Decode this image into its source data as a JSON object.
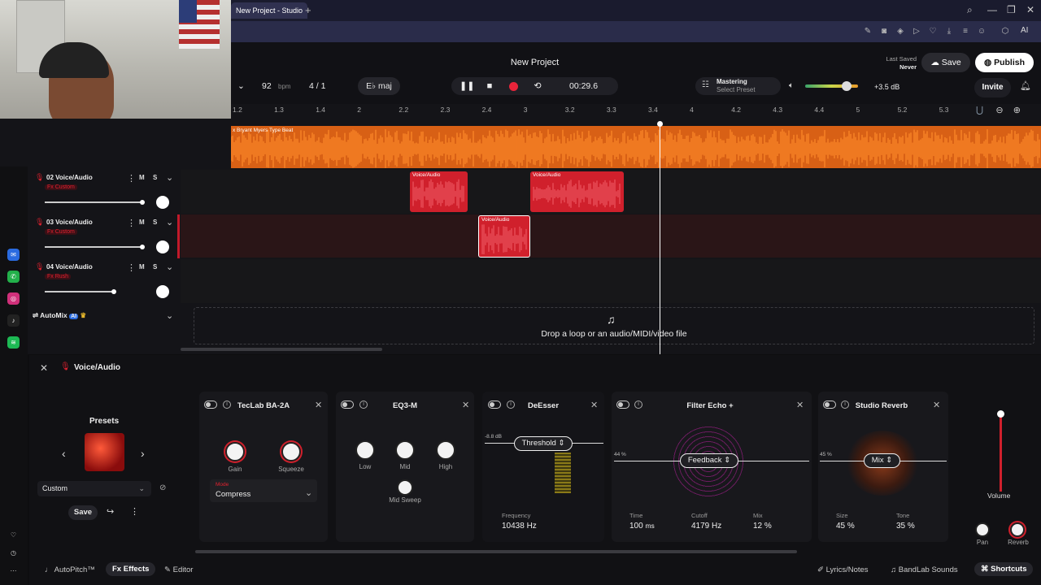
{
  "browser": {
    "tab_title": "New Project - Studio",
    "tab_plus": "+",
    "win_controls": [
      "⌕",
      "—",
      "❐",
      "✕"
    ],
    "ai_label": "AI"
  },
  "header": {
    "project_title": "New Project",
    "last_saved_label": "Last Saved",
    "last_saved_value": "Never",
    "save_label": "Save",
    "publish_label": "Publish",
    "invite_label": "Invite",
    "bpm_value": "92",
    "bpm_unit": "bpm",
    "time_signature": "4 / 1",
    "key": "E♭ maj",
    "time": "00:29.6",
    "mastering_label": "Mastering",
    "mastering_preset": "Select Preset",
    "volume_db": "+3.5 dB",
    "volume_level": 0.78
  },
  "ruler": {
    "ticks": [
      "1.2",
      "1.3",
      "1.4",
      "2",
      "2.2",
      "2.3",
      "2.4",
      "3",
      "3.2",
      "3.3",
      "3.4",
      "4",
      "4.2",
      "4.3",
      "4.4",
      "5",
      "5.2",
      "5.3"
    ]
  },
  "tracks": [
    {
      "name": "x Bryant Myers Type Beat",
      "color": "#d86015"
    },
    {
      "number": "02",
      "name": "Voice/Audio",
      "fx": "Fx Custom",
      "clips": [
        "Voice/Audio",
        "Voice/Audio"
      ]
    },
    {
      "number": "03",
      "name": "Voice/Audio",
      "fx": "Fx Custom",
      "clips": [
        "Voice/Audio"
      ]
    },
    {
      "number": "04",
      "name": "Voice/Audio",
      "fx": "Fx Rush",
      "clips": []
    }
  ],
  "track_controls": {
    "mute": "M",
    "solo": "S"
  },
  "automix": {
    "label": "AutoMix",
    "badge": "AI"
  },
  "drop_zone": {
    "text": "Drop a loop or an audio/MIDI/video file"
  },
  "fx_panel": {
    "title": "Voice/Audio",
    "presets_label": "Presets",
    "preset_value": "Custom",
    "save_label": "Save",
    "effects": [
      {
        "name": "TecLab BA-2A",
        "knobs": [
          "Gain",
          "Squeeze"
        ],
        "mode_label": "Mode",
        "mode_value": "Compress"
      },
      {
        "name": "EQ3-M",
        "knobs": [
          "Low",
          "Mid",
          "High",
          "Mid Sweep"
        ]
      },
      {
        "name": "DeEsser",
        "control": "Threshold",
        "db": "-8.8 dB",
        "frequency_label": "Frequency",
        "frequency_value": "10438 Hz"
      },
      {
        "name": "Filter Echo +",
        "control": "Feedback",
        "percent": "44 %",
        "time_label": "Time",
        "time_value": "100",
        "time_unit": "ms",
        "cutoff_label": "Cutoff",
        "cutoff_value": "4179 Hz",
        "mix_label": "Mix",
        "mix_value": "12 %"
      },
      {
        "name": "Studio Reverb",
        "control": "Mix",
        "percent": "45 %",
        "size_label": "Size",
        "size_value": "45 %",
        "tone_label": "Tone",
        "tone_value": "35 %"
      }
    ],
    "volume_label": "Volume",
    "pan_label": "Pan",
    "reverb_label": "Reverb"
  },
  "bottom_bar": {
    "autopitch": "AutoPitch™",
    "effects": "Effects",
    "editor": "Editor",
    "lyrics": "Lyrics/Notes",
    "sounds": "BandLab Sounds",
    "shortcuts": "Shortcuts"
  }
}
